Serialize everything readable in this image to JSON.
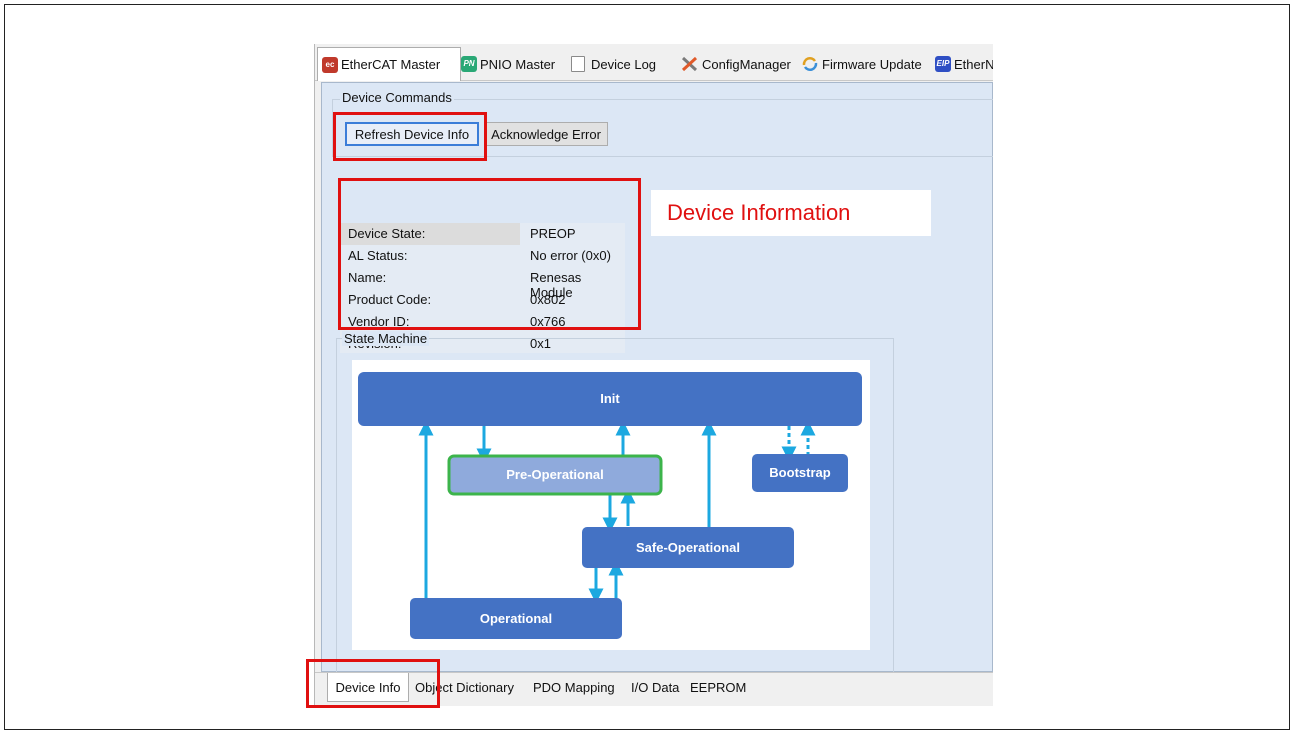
{
  "top_tabs": [
    {
      "label": "EtherCAT Master",
      "icon": "ethercat-icon"
    },
    {
      "label": "PNIO Master",
      "icon": "pn-icon"
    },
    {
      "label": "Device Log",
      "icon": "clipboard-icon"
    },
    {
      "label": "ConfigManager",
      "icon": "tools-icon"
    },
    {
      "label": "Firmware Update",
      "icon": "update-icon"
    },
    {
      "label": "EtherN",
      "icon": "eip-icon"
    }
  ],
  "commands": {
    "group_label": "Device Commands",
    "refresh_label": "Refresh Device Info",
    "ack_label": "Acknowledge Error"
  },
  "device_info": {
    "rows": [
      {
        "key": "Device State:",
        "value": "PREOP"
      },
      {
        "key": "AL Status:",
        "value": "No error (0x0)"
      },
      {
        "key": "Name:",
        "value": "Renesas Module"
      },
      {
        "key": "Product Code:",
        "value": "0x802"
      },
      {
        "key": "Vendor ID:",
        "value": "0x766"
      },
      {
        "key": "Revision:",
        "value": "0x1"
      }
    ]
  },
  "state_machine": {
    "group_label": "State Machine",
    "states": {
      "init": "Init",
      "preop": "Pre-Operational",
      "bootstrap": "Bootstrap",
      "safeop": "Safe-Operational",
      "op": "Operational"
    },
    "active_state": "preop"
  },
  "bottom_tabs": [
    "Device Info",
    "Object Dictionary",
    "PDO Mapping",
    "I/O Data",
    "EEPROM"
  ],
  "annotation": {
    "text": "Device Information"
  },
  "colors": {
    "state_fill": "#4472c4",
    "active_fill": "#8faadc",
    "active_border": "#3cb44b",
    "arrow": "#1ca8e0",
    "highlight": "#e01010"
  }
}
